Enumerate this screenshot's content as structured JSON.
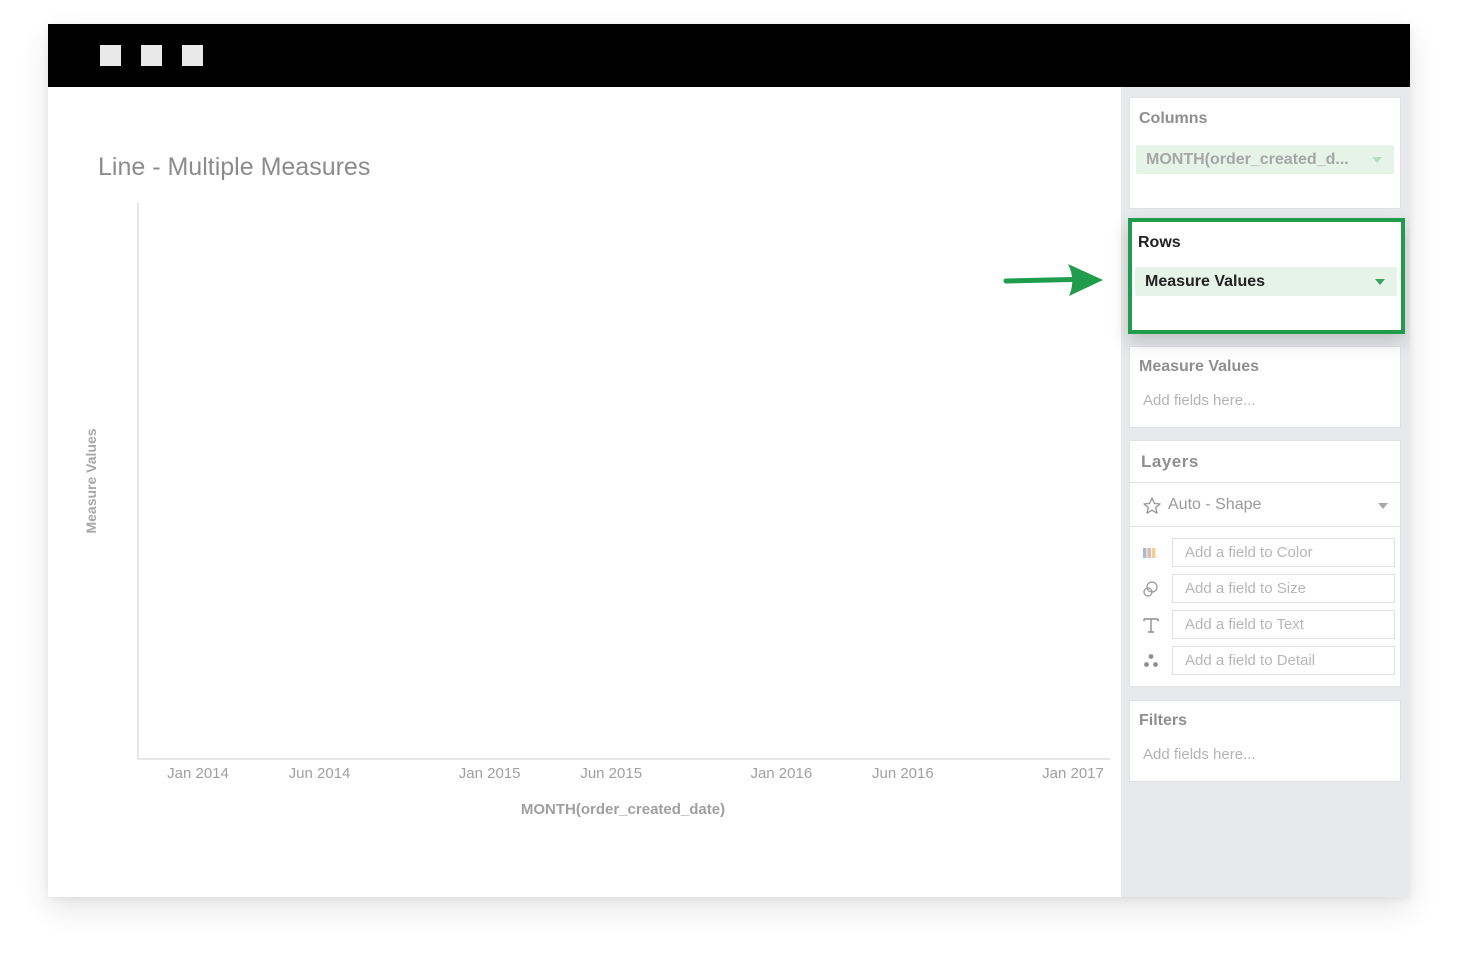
{
  "chart_data": {
    "type": "line",
    "title": "Line - Multiple Measures",
    "xlabel": "MONTH(order_created_date)",
    "ylabel": "Measure Values",
    "x_ticks": [
      "Jan 2014",
      "Jun 2014",
      "Jan 2015",
      "Jun 2015",
      "Jan 2016",
      "Jun 2016",
      "Jan 2017"
    ],
    "series": []
  },
  "sidebar": {
    "columns": {
      "title": "Columns",
      "pill": "MONTH(order_created_d..."
    },
    "rows": {
      "title": "Rows",
      "pill": "Measure Values"
    },
    "measure_values": {
      "title": "Measure Values",
      "placeholder": "Add fields here..."
    },
    "layers": {
      "title": "Layers",
      "shape_select": "Auto - Shape",
      "fields": [
        {
          "icon": "color-icon",
          "label": "Add a field to Color"
        },
        {
          "icon": "size-icon",
          "label": "Add a field to Size"
        },
        {
          "icon": "text-icon",
          "label": "Add a field to Text"
        },
        {
          "icon": "detail-icon",
          "label": "Add a field to Detail"
        }
      ]
    },
    "filters": {
      "title": "Filters",
      "placeholder": "Add fields here..."
    }
  },
  "colors": {
    "highlight": "#1f9d4d",
    "pill_bg": "#e5f3e8",
    "titlebar": "#000000"
  }
}
